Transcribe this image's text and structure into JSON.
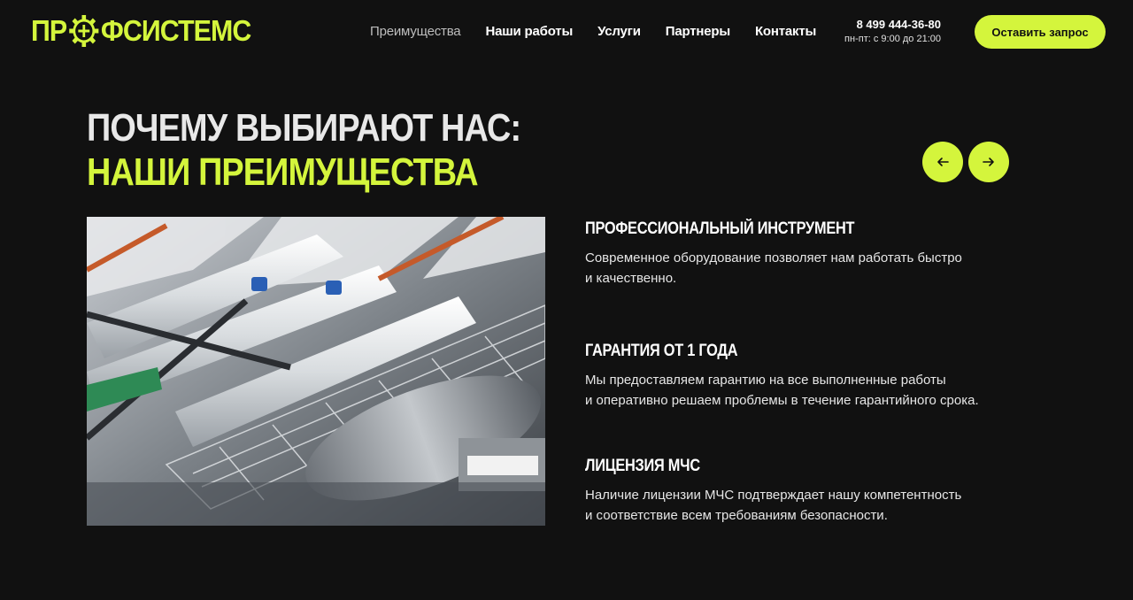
{
  "brand": {
    "logo_left": "ПР",
    "logo_right": "ФСИСТЕМС",
    "accent": "#d4f53c",
    "background": "#111111"
  },
  "nav": {
    "items": [
      {
        "label": "Преимущества"
      },
      {
        "label": "Наши работы"
      },
      {
        "label": "Услуги"
      },
      {
        "label": "Партнеры"
      },
      {
        "label": "Контакты"
      }
    ]
  },
  "contact": {
    "phone": "8 499 444-36-80",
    "hours": "пн-пт: с 9:00 до 21:00"
  },
  "cta": {
    "label": "Оставить запрос"
  },
  "section": {
    "title_line1": "Почему выбирают нас:",
    "title_line2": "Наши преимущества",
    "prev_icon": "arrow-left-icon",
    "next_icon": "arrow-right-icon"
  },
  "features": [
    {
      "title": "Профессиональный инструмент",
      "text_line1": "Современное оборудование позволяет нам работать быстро",
      "text_line2": "и качественно."
    },
    {
      "title": "Гарантия от 1 года",
      "text_line1": "Мы предоставляем гарантию на все выполненные работы",
      "text_line2": "и оперативно решаем проблемы в течение гарантийного срока."
    },
    {
      "title": "Лицензия МЧС",
      "text_line1": "Наличие лицензии МЧС подтверждает нашу компетентность",
      "text_line2": "и соответствие всем требованиям безопасности."
    }
  ]
}
